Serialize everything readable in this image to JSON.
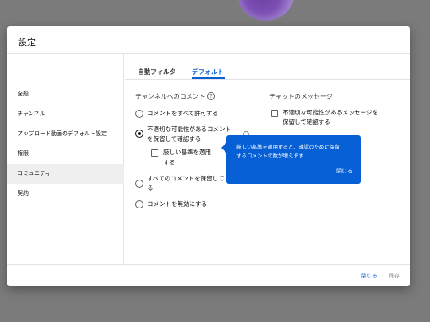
{
  "dialog": {
    "title": "設定"
  },
  "sidebar": {
    "items": [
      {
        "label": "全般"
      },
      {
        "label": "チャンネル"
      },
      {
        "label": "アップロード動画のデフォルト設定"
      },
      {
        "label": "権限"
      },
      {
        "label": "コミュニティ",
        "active": true
      },
      {
        "label": "契約"
      }
    ]
  },
  "tabs": [
    {
      "label": "自動フィルタ"
    },
    {
      "label": "デフォルト",
      "active": true
    }
  ],
  "channel_comments": {
    "title": "チャンネルへのコメント",
    "help_icon": "?",
    "options": {
      "allow_all": "コメントをすべて許可する",
      "hold_inappropriate_line1": "不適切な可能性があるコメント",
      "hold_inappropriate_line2": "を保留して確認する",
      "stricter_line1": "厳しい基準を適用",
      "stricter_line2": "する",
      "hold_all_line1": "すべてのコメントを保留して",
      "hold_all_line2": "る",
      "disable": "コメントを無効にする"
    },
    "selected": "hold_inappropriate"
  },
  "chat_messages": {
    "title": "チャットのメッセージ",
    "option_line1": "不適切な可能性があるメッセージを",
    "option_line2": "保留して確認する"
  },
  "tooltip": {
    "text_line1": "厳しい基準を適用すると、確認のために保留",
    "text_line2": "するコメントの数が増えます",
    "close_label": "閉じる"
  },
  "footer": {
    "close_label": "閉じる",
    "save_label": "保存"
  },
  "colors": {
    "accent": "#065fd4",
    "overlay": "#7b7b7b"
  }
}
